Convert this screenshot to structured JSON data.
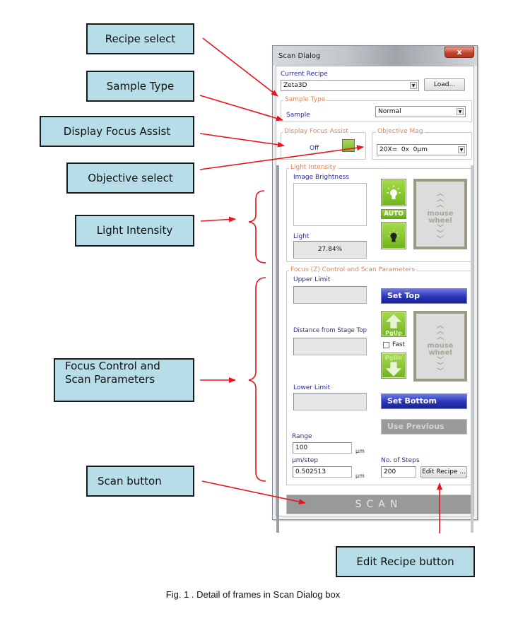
{
  "callouts": {
    "recipe_select": "Recipe select",
    "sample_type": "Sample Type",
    "display_focus_assist": "Display Focus Assist",
    "objective_select": "Objective select",
    "light_intensity": "Light Intensity",
    "focus_control": [
      "Focus Control and",
      "Scan Parameters"
    ],
    "scan_button": "Scan button",
    "edit_recipe_button": "Edit Recipe button"
  },
  "dialog": {
    "title": "Scan Dialog",
    "close_glyph": "x",
    "current_recipe": {
      "label": "Current Recipe",
      "value": "Zeta3D",
      "load_label": "Load..."
    },
    "sample_type": {
      "frame_label": "Sample Type",
      "field_label": "Sample",
      "value": "Normal"
    },
    "focus_assist": {
      "frame_label": "Display Focus Assist",
      "state": "Off",
      "indicator_color": "#8cc63f"
    },
    "objective_mag": {
      "frame_label": "Objective Mag",
      "value": "20X=  0x  0µm"
    },
    "light_intensity": {
      "frame_label": "Light Intensity",
      "brightness_label": "Image Brightness",
      "light_label": "Light",
      "light_value": "27.84%",
      "auto_label": "AUTO",
      "wheel_text": [
        "mouse",
        "wheel"
      ]
    },
    "focus": {
      "frame_label": "Focus (Z) Control and Scan Parameters",
      "upper_limit_label": "Upper Limit",
      "upper_limit_value": "",
      "distance_label": "Distance from Stage Top",
      "distance_value": "",
      "lower_limit_label": "Lower Limit",
      "lower_limit_value": "",
      "set_top_label": "Set Top",
      "set_bottom_label": "Set Bottom",
      "use_previous_label": "Use Previous",
      "pgup_label": "PgUp",
      "pgdn_label": "PgDn",
      "fast_label": "Fast",
      "fast_checked": false,
      "wheel_text": [
        "mouse",
        "wheel"
      ],
      "range_label": "Range",
      "range_value": "100",
      "range_unit": "µm",
      "step_label": "µm/step",
      "step_value": "0.502513",
      "step_unit": "µm",
      "steps_label": "No. of Steps",
      "steps_value": "200",
      "edit_recipe_label": "Edit Recipe ..."
    },
    "scan_label": "SCAN"
  },
  "caption": "Fig. 1 . Detail of frames in Scan Dialog box",
  "colors": {
    "annotation_red": "#e8141c",
    "callout_fill": "#b6dde8",
    "frame_label_orange": "#e0875c",
    "label_blue": "#2a2f8f",
    "button_blue": "#2a35b8",
    "button_green": "#8cc63f"
  }
}
